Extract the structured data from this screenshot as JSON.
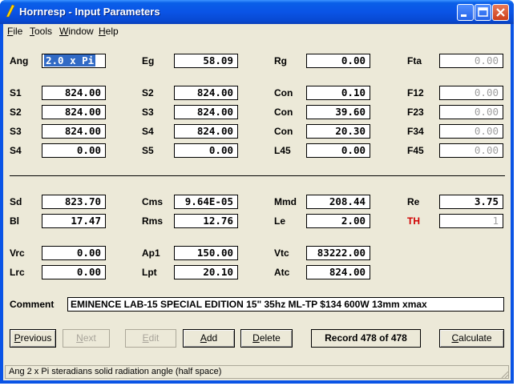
{
  "window": {
    "title": "Hornresp - Input Parameters"
  },
  "menu": [
    {
      "label": "File",
      "mn": "F",
      "rest": "ile"
    },
    {
      "label": "Tools",
      "mn": "T",
      "rest": "ools"
    },
    {
      "label": "Window",
      "mn": "W",
      "rest": "indow"
    },
    {
      "label": "Help",
      "mn": "H",
      "rest": "elp"
    }
  ],
  "params": {
    "ang": {
      "label": "Ang",
      "value": "2.0 x Pi"
    },
    "eg": {
      "label": "Eg",
      "value": "58.09"
    },
    "rg": {
      "label": "Rg",
      "value": "0.00"
    },
    "fta": {
      "label": "Fta",
      "value": "0.00"
    },
    "s1": {
      "label": "S1",
      "value": "824.00"
    },
    "s2a": {
      "label": "S2",
      "value": "824.00"
    },
    "con1": {
      "label": "Con",
      "value": "0.10"
    },
    "f12": {
      "label": "F12",
      "value": "0.00"
    },
    "s2": {
      "label": "S2",
      "value": "824.00"
    },
    "s3a": {
      "label": "S3",
      "value": "824.00"
    },
    "con2": {
      "label": "Con",
      "value": "39.60"
    },
    "f23": {
      "label": "F23",
      "value": "0.00"
    },
    "s3": {
      "label": "S3",
      "value": "824.00"
    },
    "s4a": {
      "label": "S4",
      "value": "824.00"
    },
    "con3": {
      "label": "Con",
      "value": "20.30"
    },
    "f34": {
      "label": "F34",
      "value": "0.00"
    },
    "s4": {
      "label": "S4",
      "value": "0.00"
    },
    "s5": {
      "label": "S5",
      "value": "0.00"
    },
    "l45": {
      "label": "L45",
      "value": "0.00"
    },
    "f45": {
      "label": "F45",
      "value": "0.00"
    },
    "sd": {
      "label": "Sd",
      "value": "823.70"
    },
    "cms": {
      "label": "Cms",
      "value": "9.64E-05"
    },
    "mmd": {
      "label": "Mmd",
      "value": "208.44"
    },
    "re": {
      "label": "Re",
      "value": "3.75"
    },
    "bl": {
      "label": "Bl",
      "value": "17.47"
    },
    "rms": {
      "label": "Rms",
      "value": "12.76"
    },
    "le": {
      "label": "Le",
      "value": "2.00"
    },
    "th": {
      "label": "TH",
      "value": "1"
    },
    "vrc": {
      "label": "Vrc",
      "value": "0.00"
    },
    "ap1": {
      "label": "Ap1",
      "value": "150.00"
    },
    "vtc": {
      "label": "Vtc",
      "value": "83222.00"
    },
    "lrc": {
      "label": "Lrc",
      "value": "0.00"
    },
    "lpt": {
      "label": "Lpt",
      "value": "20.10"
    },
    "atc": {
      "label": "Atc",
      "value": "824.00"
    }
  },
  "comment": {
    "label": "Comment",
    "value": "EMINENCE LAB-15 SPECIAL EDITION 15\" 35hz ML-TP $134 600W 13mm xmax"
  },
  "buttons": {
    "previous": {
      "mn": "P",
      "rest": "revious"
    },
    "next": {
      "mn": "N",
      "rest": "ext"
    },
    "edit": {
      "mn": "E",
      "rest": "dit"
    },
    "add": {
      "mn": "A",
      "rest": "dd"
    },
    "delete": {
      "mn": "D",
      "rest": "elete"
    },
    "calculate": {
      "mn": "C",
      "rest": "alculate"
    }
  },
  "record": "Record 478 of 478",
  "status": "Ang   2 x Pi steradians solid radiation angle  (half space)",
  "colors": {
    "title_blue": "#0a54e6",
    "face": "#ece9d8",
    "th_label": "#d00000",
    "selection": "#316ac5"
  }
}
